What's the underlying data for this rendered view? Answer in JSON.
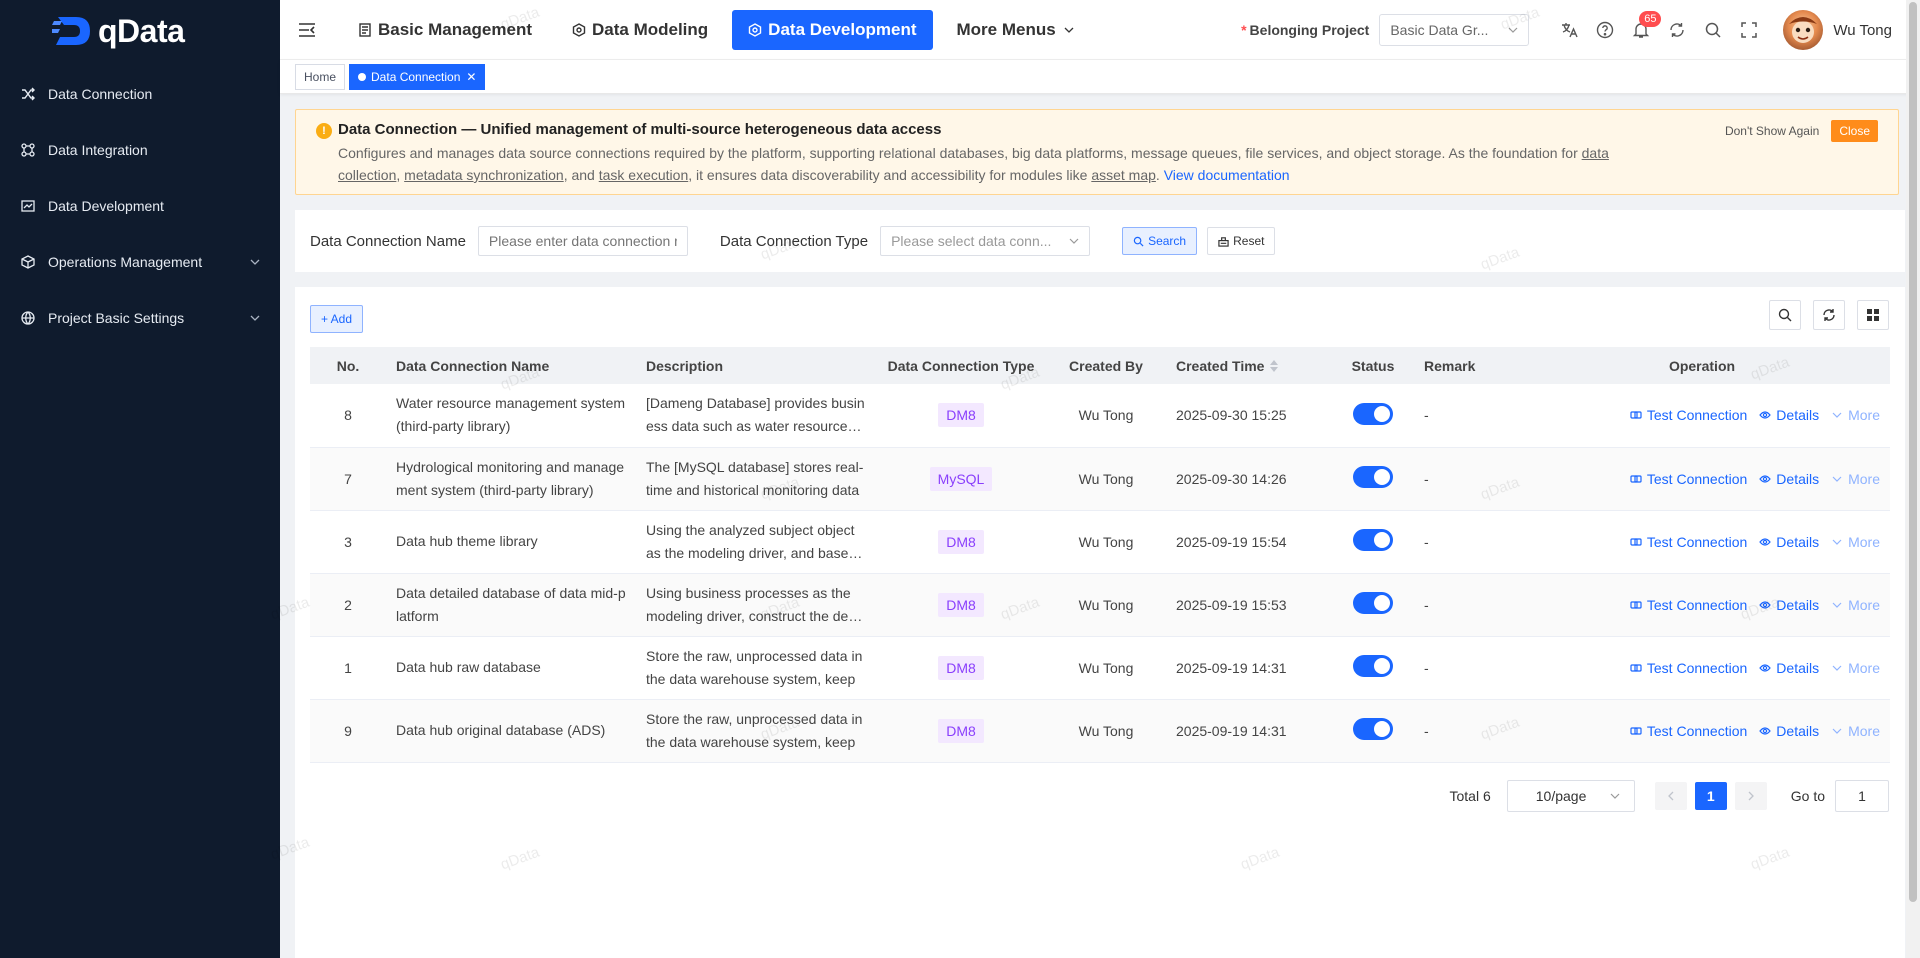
{
  "app": {
    "logo_text": "qData"
  },
  "sidebar": {
    "items": [
      {
        "label": "Data Connection",
        "icon": "shuffle-icon",
        "expandable": false
      },
      {
        "label": "Data Integration",
        "icon": "nodes-icon",
        "expandable": false
      },
      {
        "label": "Data Development",
        "icon": "chart-icon",
        "expandable": false
      },
      {
        "label": "Operations Management",
        "icon": "cube-icon",
        "expandable": true
      },
      {
        "label": "Project Basic Settings",
        "icon": "globe-icon",
        "expandable": true
      }
    ]
  },
  "header": {
    "tabs": [
      {
        "label": "Basic Management",
        "active": false
      },
      {
        "label": "Data Modeling",
        "active": false
      },
      {
        "label": "Data Development",
        "active": true
      },
      {
        "label": "More Menus",
        "active": false
      }
    ],
    "project_label": "Belonging Project",
    "project_required_mark": "*",
    "project_value": "Basic Data Gr...",
    "notification_count": "65",
    "user_name": "Wu Tong"
  },
  "tags": {
    "home": "Home",
    "current": "Data Connection"
  },
  "notice": {
    "title": "Data Connection — Unified management of multi-source heterogeneous data access",
    "body_1": "Configures and manages data source connections required by the platform, supporting relational databases, big data platforms, message queues, file services, and object storage. As the foundation for ",
    "link_1": "data collection",
    "sep_1": ", ",
    "link_2": "metadata synchronization",
    "sep_2": ", and ",
    "link_3": "task execution",
    "body_2": ", it ensures data discoverability and accessibility for modules like ",
    "link_4": "asset map",
    "body_3": ". ",
    "doc_link": "View documentation",
    "dont_show": "Don't Show Again",
    "close": "Close"
  },
  "search": {
    "name_label": "Data Connection Name",
    "name_placeholder": "Please enter data connection name",
    "type_label": "Data Connection Type",
    "type_placeholder": "Please select data conn...",
    "search_btn": "Search",
    "reset_btn": "Reset"
  },
  "table": {
    "add_btn": "+ Add",
    "columns": [
      "No.",
      "Data Connection Name",
      "Description",
      "Data Connection Type",
      "Created By",
      "Created Time",
      "Status",
      "Remark",
      "Operation"
    ],
    "rows": [
      {
        "no": "8",
        "name": "Water resource management system (third-party library)",
        "desc": "[Dameng Database] provides business data such as water resources management",
        "type": "DM8",
        "created_by": "Wu Tong",
        "created_time": "2025-09-30 15:25",
        "status": true,
        "remark": "-"
      },
      {
        "no": "7",
        "name": "Hydrological monitoring and management system (third-party library)",
        "desc": "The [MySQL database] stores real-time and historical monitoring data",
        "type": "MySQL",
        "created_by": "Wu Tong",
        "created_time": "2025-09-30 14:26",
        "status": true,
        "remark": "-"
      },
      {
        "no": "3",
        "name": "Data hub theme library",
        "desc": "Using the analyzed subject object as the modeling driver, and based on",
        "type": "DM8",
        "created_by": "Wu Tong",
        "created_time": "2025-09-19 15:54",
        "status": true,
        "remark": "-"
      },
      {
        "no": "2",
        "name": "Data detailed database of data mid-platform",
        "desc": "Using business processes as the modeling driver, construct the detailed",
        "type": "DM8",
        "created_by": "Wu Tong",
        "created_time": "2025-09-19 15:53",
        "status": true,
        "remark": "-"
      },
      {
        "no": "1",
        "name": "Data hub raw database",
        "desc": "Store the raw, unprocessed data in the data warehouse system, keep",
        "type": "DM8",
        "created_by": "Wu Tong",
        "created_time": "2025-09-19 14:31",
        "status": true,
        "remark": "-"
      },
      {
        "no": "9",
        "name": "Data hub original database (ADS)",
        "desc": "Store the raw, unprocessed data in the data warehouse system, keep",
        "type": "DM8",
        "created_by": "Wu Tong",
        "created_time": "2025-09-19 14:31",
        "status": true,
        "remark": "-"
      }
    ],
    "op_test": "Test Connection",
    "op_details": "Details",
    "op_more": "More"
  },
  "pagination": {
    "total": "Total 6",
    "page_size": "10/page",
    "current_page": "1",
    "goto_label": "Go to",
    "goto_value": "1"
  },
  "watermark": "qData",
  "colors": {
    "primary": "#1a66ff",
    "sidebar_bg": "#0f1b2d",
    "notice_bg": "#fff7e8",
    "close_btn": "#ff8c1a",
    "type_tag": "#8a3ffc"
  }
}
